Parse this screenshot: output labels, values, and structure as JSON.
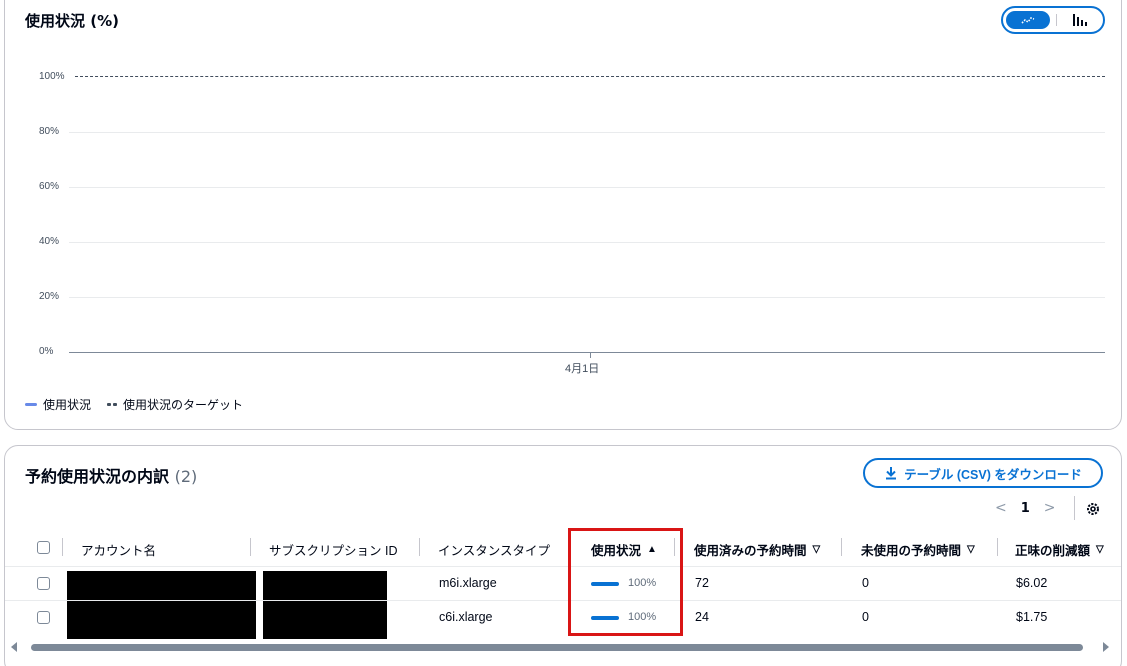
{
  "chart_card": {
    "title": "使用状況 (%)",
    "toggle": {
      "selected": "line",
      "options": [
        "line-chart-icon",
        "bar-chart-icon"
      ]
    },
    "legend": {
      "utilization": "使用状況",
      "target": "使用状況のターゲット"
    }
  },
  "chart_data": {
    "type": "line",
    "x": [
      "4月1日"
    ],
    "yticks": [
      "100%",
      "80%",
      "60%",
      "40%",
      "20%",
      "0%"
    ],
    "ylim": [
      0,
      100
    ],
    "series": [
      {
        "name": "使用状況",
        "values": [],
        "color": "#688ae8"
      },
      {
        "name": "使用状況のターゲット",
        "values": [
          100
        ],
        "color": "#414d5c"
      }
    ],
    "grid": true,
    "legend_position": "bottom-left"
  },
  "table_card": {
    "title": "予約使用状況の内訳",
    "count": "(2)",
    "csv_button": "テーブル (CSV) をダウンロード",
    "pager": {
      "current": "1"
    },
    "columns": [
      "アカウント名",
      "サブスクリプション ID",
      "インスタンスタイプ",
      "使用状況",
      "使用済みの予約時間",
      "未使用の予約時間",
      "正味の削減額"
    ],
    "rows": [
      {
        "instance_type": "m6i.xlarge",
        "utilization": "100%",
        "utilization_value": 100,
        "used_hours": "72",
        "unused_hours": "0",
        "net_savings": "$6.02"
      },
      {
        "instance_type": "c6i.xlarge",
        "utilization": "100%",
        "utilization_value": 100,
        "used_hours": "24",
        "unused_hours": "0",
        "net_savings": "$1.75"
      }
    ]
  },
  "colors": {
    "accent": "#0972d3",
    "highlight": "#d91515",
    "series_line": "#688ae8"
  }
}
